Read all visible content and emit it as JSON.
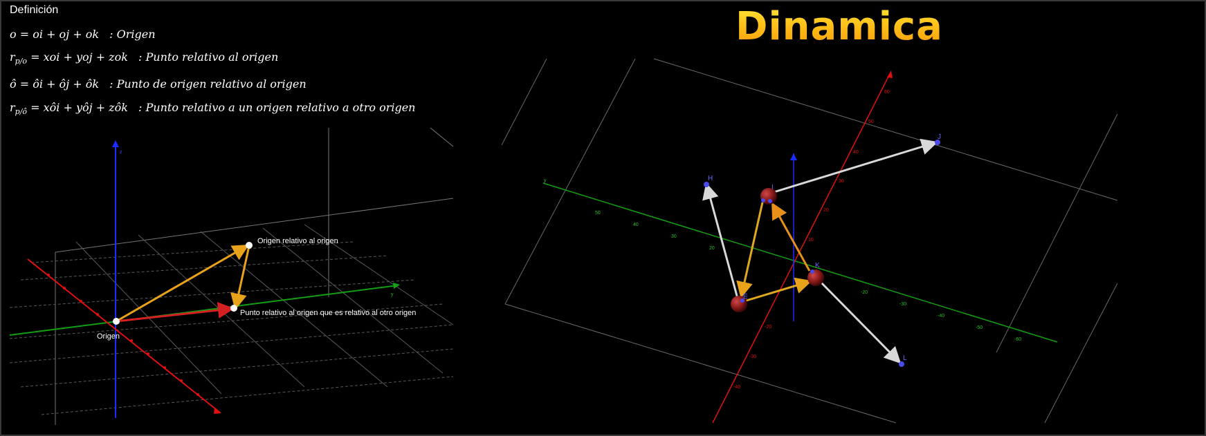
{
  "definition": {
    "title": "Definición",
    "equations": [
      {
        "lhs": "o",
        "sub": "",
        "rhs": "= oi + oj + ok",
        "desc": ": Origen"
      },
      {
        "lhs": "r",
        "sub": "p/o",
        "rhs": "= xoi + yoj + zok",
        "desc": ": Punto relativo al origen"
      },
      {
        "lhs": "ô",
        "sub": "",
        "rhs": "= ôi + ôj + ôk",
        "desc": ": Punto de origen relativo al origen"
      },
      {
        "lhs": "r",
        "sub": "p/ô",
        "rhs": "= xôi + yôj + zôk",
        "desc": ": Punto relativo a un origen relativo a otro origen"
      }
    ]
  },
  "left_diagram": {
    "labels": {
      "origin": "Origen",
      "relative_origin": "Origen relativo al origen",
      "relative_point": "Punto relativo al origen que es relativo al otro origen",
      "axis_y": "y",
      "axis_z": "z"
    },
    "colors": {
      "x_axis": "#e01010",
      "y_axis": "#12a012",
      "z_axis": "#1a2cff",
      "vector": "#e8a31a",
      "red_vector": "#d42020"
    }
  },
  "right_diagram": {
    "title": "Dinamica",
    "points": {
      "H": "H",
      "J": "J",
      "K": "K",
      "L": "L",
      "I": "I",
      "E": "E"
    },
    "axis_y": "y",
    "colors": {
      "white_vector": "#d8d8d8",
      "orange_vector": "#e8901a",
      "gold_vector": "#e0a820",
      "sphere": "#8a1a1a",
      "point": "#4040e0"
    }
  }
}
